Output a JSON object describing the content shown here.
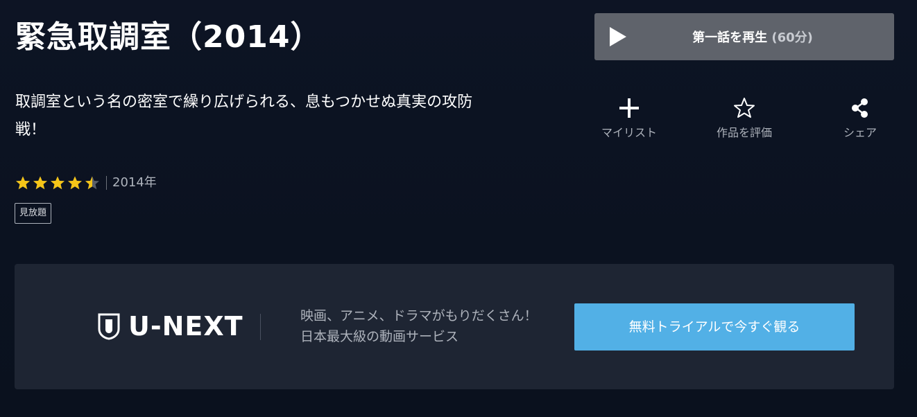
{
  "header": {
    "title": "緊急取調室（2014）"
  },
  "play_button": {
    "label": "第一話を再生",
    "duration": "(60分)",
    "icon": "play-icon"
  },
  "description": "取調室という名の密室で繰り広げられる、息もつかせぬ真実の攻防戦！",
  "actions": {
    "mylist": {
      "label": "マイリスト",
      "icon": "plus-icon"
    },
    "rate": {
      "label": "作品を評価",
      "icon": "star-outline-icon"
    },
    "share": {
      "label": "シェア",
      "icon": "share-icon"
    }
  },
  "rating": {
    "value": 4.5,
    "max": 5,
    "star_color": "#f5c518"
  },
  "year": "2014年",
  "badge": "見放題",
  "banner": {
    "logo_text": "U-NEXT",
    "copy_line1": "映画、アニメ、ドラマがもりだくさん！",
    "copy_line2": "日本最大級の動画サービス",
    "cta_label": "無料トライアルで今すぐ観る",
    "cta_color": "#52b0e6"
  }
}
